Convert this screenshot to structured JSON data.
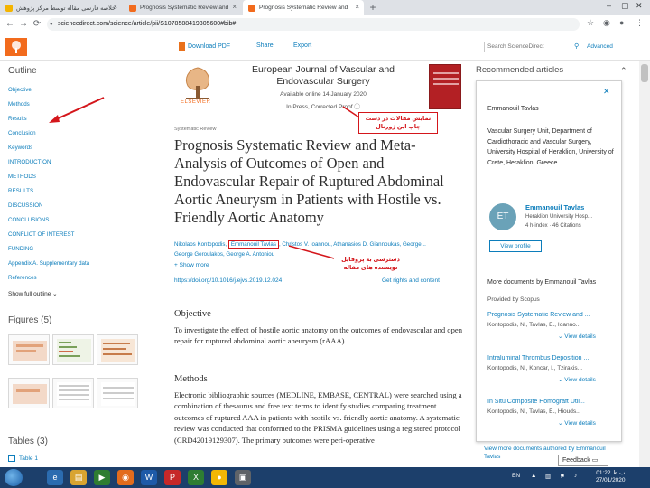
{
  "browser": {
    "tabs": [
      {
        "label": "خلاصه فارسی مقاله توسط مرکز پژوهش",
        "favicon_color": "#f4b400"
      },
      {
        "label": "Prognosis Systematic Review and",
        "favicon_color": "#f26b1d"
      },
      {
        "label": "Prognosis Systematic Review and",
        "favicon_color": "#f26b1d"
      }
    ],
    "new_tab": "+",
    "close": "×",
    "url": "sciencedirect.com/science/article/pii/S1078588419305600#bib#",
    "back": "←",
    "forward": "→",
    "reload": "⟳",
    "star": "☆"
  },
  "toolbar": {
    "download_pdf": "Download PDF",
    "share": "Share",
    "export": "Export",
    "search_placeholder": "Search ScienceDirect",
    "advanced": "Advanced"
  },
  "outline": {
    "title": "Outline",
    "items": [
      "Objective",
      "Methods",
      "Results",
      "Conclusion",
      "Keywords",
      "INTRODUCTION",
      "METHODS",
      "RESULTS",
      "DISCUSSION",
      "CONCLUSIONS",
      "CONFLICT OF INTEREST",
      "FUNDING",
      "Appendix A. Supplementary data",
      "References"
    ],
    "show_full": "Show full outline",
    "figures_title": "Figures (5)",
    "tables_title": "Tables (3)",
    "table_item": "Table 1"
  },
  "article": {
    "journal": "European Journal of Vascular and Endovascular Surgery",
    "available": "Available online 14 January 2020",
    "in_press": "In Press, Corrected Proof",
    "publisher": "ELSEVIER",
    "type": "Systematic Review",
    "title": "Prognosis Systematic Review and Meta-Analysis of Outcomes of Open and Endovascular Repair of Ruptured Abdominal Aortic Aneurysm in Patients with Hostile vs. Friendly Aortic Anatomy",
    "authors_line1_pre": "Nikolaos Kontopodis",
    "authors_boxed": "Emmanouil Tavlas",
    "authors_line1_post": "Christos V. Ioannou, Athanasios D. Giannoukas, George...",
    "authors_line2": "George Geroulakos, George A. Antoniou",
    "show_more": "Show more",
    "doi": "https://doi.org/10.1016/j.ejvs.2019.12.024",
    "rights": "Get rights and content",
    "objective_h": "Objective",
    "objective_text": "To investigate the effect of hostile aortic anatomy on the outcomes of endovascular and open repair for ruptured abdominal aortic aneurysm (rAAA).",
    "methods_h": "Methods",
    "methods_text": "Electronic bibliographic sources (MEDLINE, EMBASE, CENTRAL) were searched using a combination of thesaurus and free text terms to identify studies comparing treatment outcomes of ruptured AAA in patients with hostile vs. friendly aortic anatomy. A systematic review was conducted that conformed to the PRISMA guidelines using a registered protocol (CRD42019129307). The primary outcomes were peri-operative"
  },
  "annotations": {
    "print_box": "نمایش مقالات در دست چاپ این ژورنال",
    "author_note": "دسترسی به پروفایل نویسنده های مقاله"
  },
  "rightpanel": {
    "recommended": "Recommended articles",
    "card_name": "Emmanouil Tavlas",
    "affiliation": "Vascular Surgery Unit, Department of Cardiothoracic and Vascular Surgery, University Hospital of Heraklion, University of Crete, Heraklion, Greece",
    "initials": "ET",
    "profile_name": "Emmanouil Tavlas",
    "university": "Heraklion University Hosp...",
    "hindex": "4 h-index · 46 Citations",
    "view_profile": "View profile",
    "more_docs": "More documents by Emmanouil Tavlas",
    "provided_by": "Provided by Scopus",
    "docs": [
      {
        "title": "Prognosis Systematic Review and ...",
        "authors": "Kontopodis, N., Tavlas, E., Ioanno..."
      },
      {
        "title": "Intraluminal Thrombus Deposition ...",
        "authors": "Kontopodis, N., Koncar, I., Tzirakis..."
      },
      {
        "title": "In Situ Composite Homograft Util...",
        "authors": "Kontopodis, N., Tavlas, E., Hiouds..."
      }
    ],
    "view_details": "View details",
    "view_more": "View more documents authored by Emmanouil Tavlas",
    "feedback": "Feedback"
  },
  "taskbar": {
    "lang": "EN",
    "time": "01:22 ب.ظ",
    "date": "27/01/2020"
  }
}
